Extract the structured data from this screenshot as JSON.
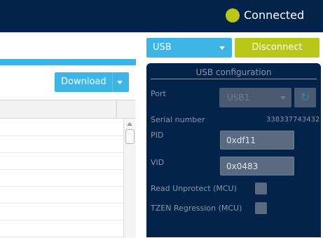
{
  "header": {
    "connection_status": "Connected",
    "status_color": "#b9c818"
  },
  "left": {
    "download_label": "Download"
  },
  "right": {
    "interface_select": "USB",
    "disconnect_label": "Disconnect",
    "config": {
      "title": "USB configuration",
      "port_label": "Port",
      "port_value": "USB1",
      "serial_label": "Serial number",
      "serial_value": "338337743432",
      "pid_label": "PID",
      "pid_value": "0xdf11",
      "vid_label": "VID",
      "vid_value": "0x0483",
      "read_unprotect_label": "Read Unprotect (MCU)",
      "tzen_label": "TZEN Regression (MCU)"
    },
    "icons": [
      "chevron-down-icon",
      "refresh-icon"
    ]
  }
}
